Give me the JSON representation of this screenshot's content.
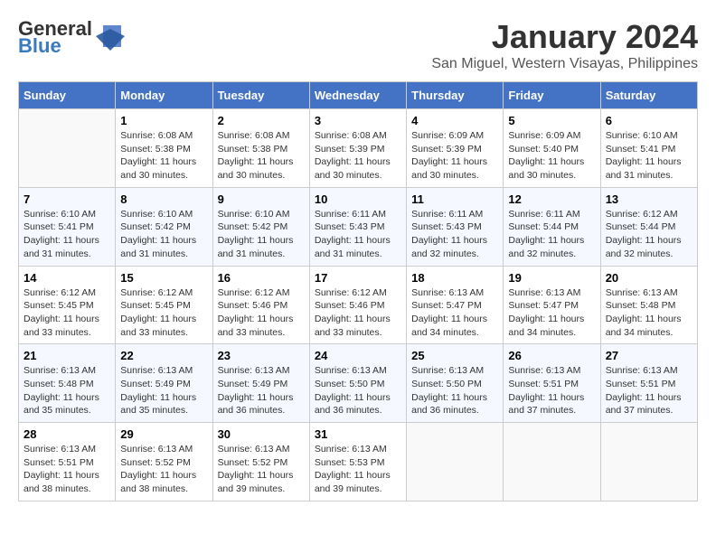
{
  "logo": {
    "general": "General",
    "blue": "Blue"
  },
  "title": "January 2024",
  "subtitle": "San Miguel, Western Visayas, Philippines",
  "days_of_week": [
    "Sunday",
    "Monday",
    "Tuesday",
    "Wednesday",
    "Thursday",
    "Friday",
    "Saturday"
  ],
  "weeks": [
    [
      {
        "day": "",
        "info": ""
      },
      {
        "day": "1",
        "info": "Sunrise: 6:08 AM\nSunset: 5:38 PM\nDaylight: 11 hours\nand 30 minutes."
      },
      {
        "day": "2",
        "info": "Sunrise: 6:08 AM\nSunset: 5:38 PM\nDaylight: 11 hours\nand 30 minutes."
      },
      {
        "day": "3",
        "info": "Sunrise: 6:08 AM\nSunset: 5:39 PM\nDaylight: 11 hours\nand 30 minutes."
      },
      {
        "day": "4",
        "info": "Sunrise: 6:09 AM\nSunset: 5:39 PM\nDaylight: 11 hours\nand 30 minutes."
      },
      {
        "day": "5",
        "info": "Sunrise: 6:09 AM\nSunset: 5:40 PM\nDaylight: 11 hours\nand 30 minutes."
      },
      {
        "day": "6",
        "info": "Sunrise: 6:10 AM\nSunset: 5:41 PM\nDaylight: 11 hours\nand 31 minutes."
      }
    ],
    [
      {
        "day": "7",
        "info": "Sunrise: 6:10 AM\nSunset: 5:41 PM\nDaylight: 11 hours\nand 31 minutes."
      },
      {
        "day": "8",
        "info": "Sunrise: 6:10 AM\nSunset: 5:42 PM\nDaylight: 11 hours\nand 31 minutes."
      },
      {
        "day": "9",
        "info": "Sunrise: 6:10 AM\nSunset: 5:42 PM\nDaylight: 11 hours\nand 31 minutes."
      },
      {
        "day": "10",
        "info": "Sunrise: 6:11 AM\nSunset: 5:43 PM\nDaylight: 11 hours\nand 31 minutes."
      },
      {
        "day": "11",
        "info": "Sunrise: 6:11 AM\nSunset: 5:43 PM\nDaylight: 11 hours\nand 32 minutes."
      },
      {
        "day": "12",
        "info": "Sunrise: 6:11 AM\nSunset: 5:44 PM\nDaylight: 11 hours\nand 32 minutes."
      },
      {
        "day": "13",
        "info": "Sunrise: 6:12 AM\nSunset: 5:44 PM\nDaylight: 11 hours\nand 32 minutes."
      }
    ],
    [
      {
        "day": "14",
        "info": "Sunrise: 6:12 AM\nSunset: 5:45 PM\nDaylight: 11 hours\nand 33 minutes."
      },
      {
        "day": "15",
        "info": "Sunrise: 6:12 AM\nSunset: 5:45 PM\nDaylight: 11 hours\nand 33 minutes."
      },
      {
        "day": "16",
        "info": "Sunrise: 6:12 AM\nSunset: 5:46 PM\nDaylight: 11 hours\nand 33 minutes."
      },
      {
        "day": "17",
        "info": "Sunrise: 6:12 AM\nSunset: 5:46 PM\nDaylight: 11 hours\nand 33 minutes."
      },
      {
        "day": "18",
        "info": "Sunrise: 6:13 AM\nSunset: 5:47 PM\nDaylight: 11 hours\nand 34 minutes."
      },
      {
        "day": "19",
        "info": "Sunrise: 6:13 AM\nSunset: 5:47 PM\nDaylight: 11 hours\nand 34 minutes."
      },
      {
        "day": "20",
        "info": "Sunrise: 6:13 AM\nSunset: 5:48 PM\nDaylight: 11 hours\nand 34 minutes."
      }
    ],
    [
      {
        "day": "21",
        "info": "Sunrise: 6:13 AM\nSunset: 5:48 PM\nDaylight: 11 hours\nand 35 minutes."
      },
      {
        "day": "22",
        "info": "Sunrise: 6:13 AM\nSunset: 5:49 PM\nDaylight: 11 hours\nand 35 minutes."
      },
      {
        "day": "23",
        "info": "Sunrise: 6:13 AM\nSunset: 5:49 PM\nDaylight: 11 hours\nand 36 minutes."
      },
      {
        "day": "24",
        "info": "Sunrise: 6:13 AM\nSunset: 5:50 PM\nDaylight: 11 hours\nand 36 minutes."
      },
      {
        "day": "25",
        "info": "Sunrise: 6:13 AM\nSunset: 5:50 PM\nDaylight: 11 hours\nand 36 minutes."
      },
      {
        "day": "26",
        "info": "Sunrise: 6:13 AM\nSunset: 5:51 PM\nDaylight: 11 hours\nand 37 minutes."
      },
      {
        "day": "27",
        "info": "Sunrise: 6:13 AM\nSunset: 5:51 PM\nDaylight: 11 hours\nand 37 minutes."
      }
    ],
    [
      {
        "day": "28",
        "info": "Sunrise: 6:13 AM\nSunset: 5:51 PM\nDaylight: 11 hours\nand 38 minutes."
      },
      {
        "day": "29",
        "info": "Sunrise: 6:13 AM\nSunset: 5:52 PM\nDaylight: 11 hours\nand 38 minutes."
      },
      {
        "day": "30",
        "info": "Sunrise: 6:13 AM\nSunset: 5:52 PM\nDaylight: 11 hours\nand 39 minutes."
      },
      {
        "day": "31",
        "info": "Sunrise: 6:13 AM\nSunset: 5:53 PM\nDaylight: 11 hours\nand 39 minutes."
      },
      {
        "day": "",
        "info": ""
      },
      {
        "day": "",
        "info": ""
      },
      {
        "day": "",
        "info": ""
      }
    ]
  ]
}
